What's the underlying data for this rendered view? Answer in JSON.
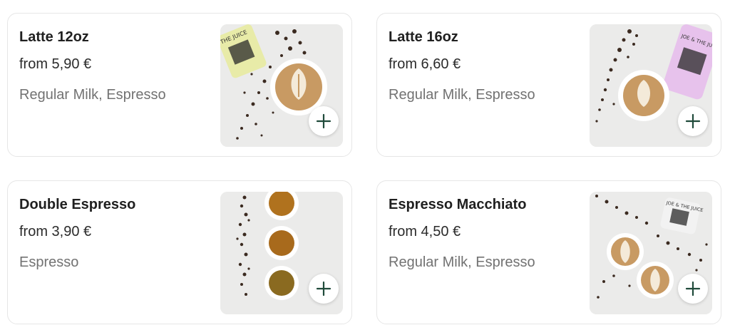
{
  "products": [
    {
      "name": "Latte 12oz",
      "price": "from 5,90 €",
      "ingredients": "Regular Milk, Espresso",
      "image_icon": "latte-photo-icon",
      "cup_color": "#e8eba8",
      "cup_text": "THE JUICE"
    },
    {
      "name": "Latte 16oz",
      "price": "from 6,60 €",
      "ingredients": "Regular Milk, Espresso",
      "image_icon": "latte-photo-icon",
      "cup_color": "#e7c2ec",
      "cup_text": "JOE & THE JUICE"
    },
    {
      "name": "Double Espresso",
      "price": "from 3,90 €",
      "ingredients": "Espresso",
      "image_icon": "espresso-cups-photo-icon"
    },
    {
      "name": "Espresso Macchiato",
      "price": "from 4,50 €",
      "ingredients": "Regular Milk, Espresso",
      "image_icon": "macchiato-photo-icon",
      "cup_color": "#f2f2f2",
      "cup_text": "JOE & THE JUICE"
    }
  ],
  "add_button_icon": "plus-icon",
  "colors": {
    "accent": "#1f4a3a",
    "card_border": "#e6e6e6",
    "secondary_text": "#727272",
    "coffee_foam": "#c89a63",
    "crema": "#b0721e"
  }
}
